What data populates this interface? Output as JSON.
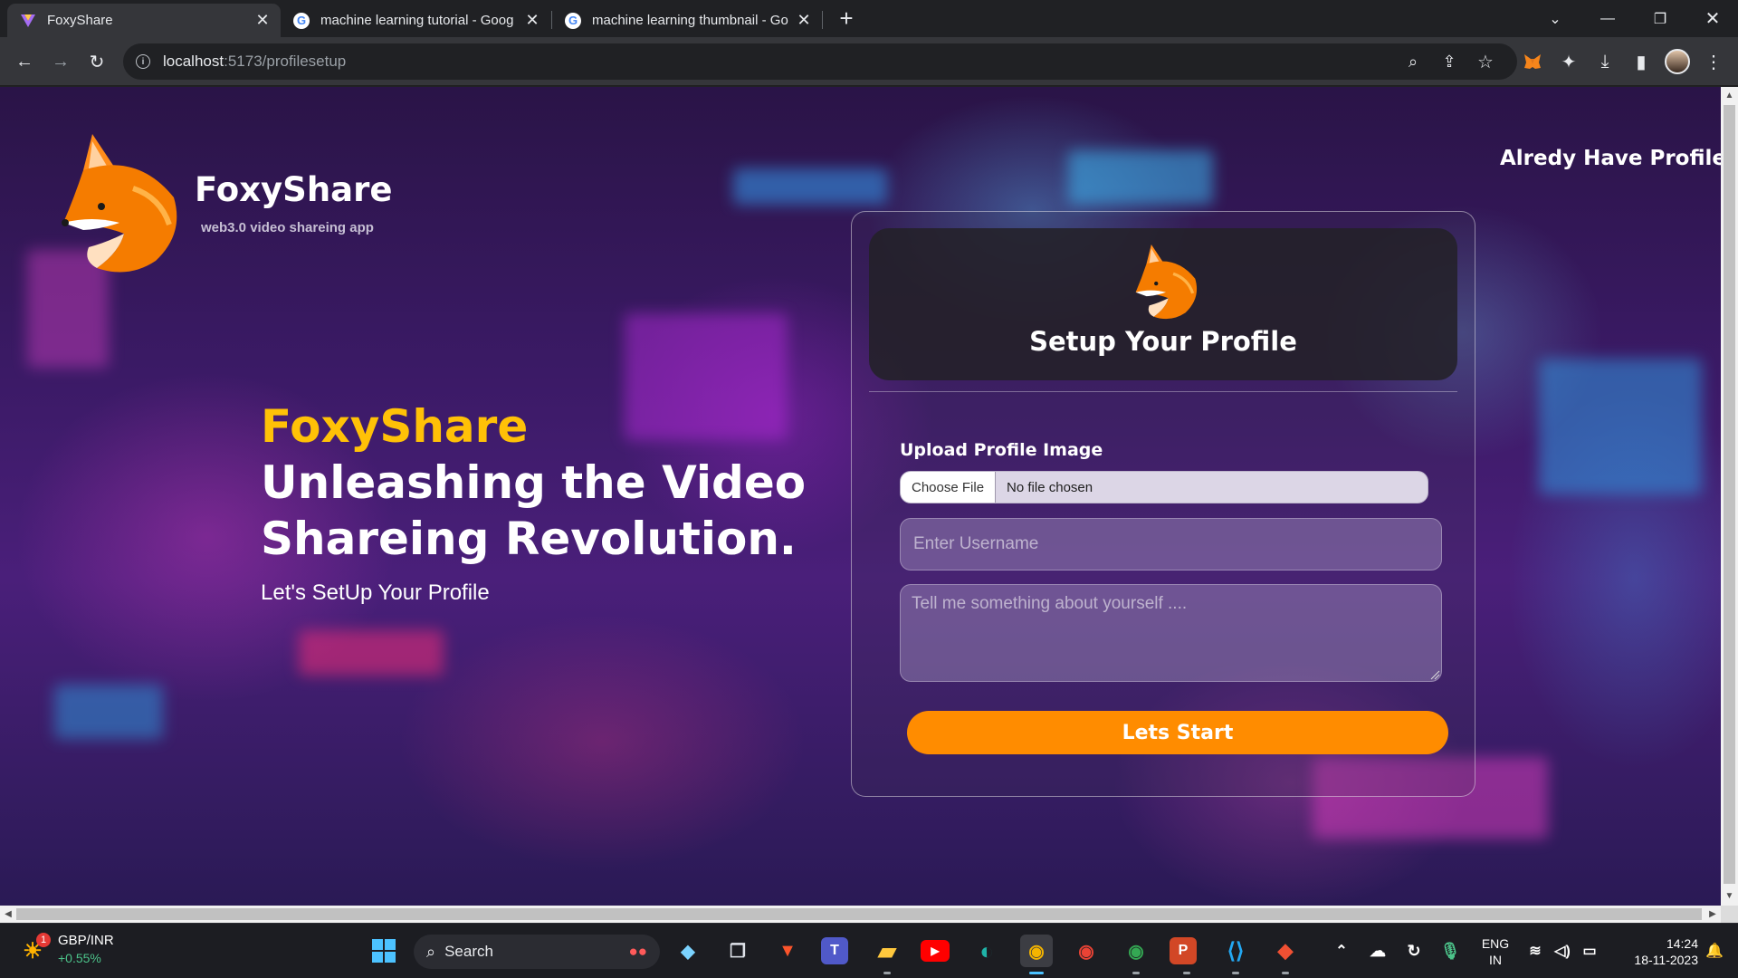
{
  "browser": {
    "tabs": [
      {
        "title": "FoxyShare",
        "active": true
      },
      {
        "title": "machine learning tutorial - Goog",
        "active": false
      },
      {
        "title": "machine learning thumbnail - Go",
        "active": false
      }
    ],
    "url_host": "localhost",
    "url_path": ":5173/profilesetup"
  },
  "page": {
    "brand_name": "FoxyShare",
    "brand_tagline": "web3.0 video shareing app",
    "already_link": "Alredy Have Profile",
    "hero_brand": "FoxyShare",
    "hero_line1": "Unleashing the Video",
    "hero_line2": "Shareing Revolution.",
    "hero_sub": "Let's SetUp Your Profile",
    "card": {
      "title": "Setup Your Profile",
      "upload_label": "Upload Profile Image",
      "choose_file": "Choose File",
      "no_file": "No file chosen",
      "username_placeholder": "Enter Username",
      "about_placeholder": "Tell me something about yourself ....",
      "submit_label": "Lets Start"
    },
    "colors": {
      "accent": "#ff8c00",
      "hero_brand": "#ffc107"
    }
  },
  "taskbar": {
    "ticker_name": "GBP/INR",
    "ticker_change": "+0.55%",
    "ticker_badge": "1",
    "search_label": "Search",
    "lang": "ENG",
    "region": "IN",
    "time": "14:24",
    "date": "18-11-2023"
  }
}
